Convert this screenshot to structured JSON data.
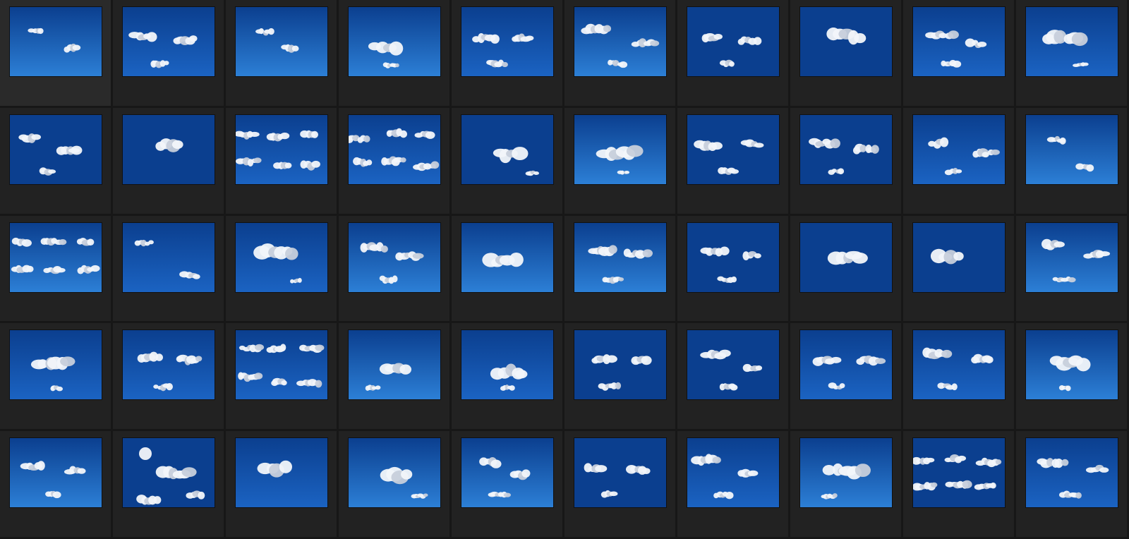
{
  "grid": {
    "rows": 5,
    "columns": 10,
    "colors": {
      "background": "#1f1f1f",
      "cell": "#222222",
      "separator": "#171717",
      "sky_deep": "#0b3f8f",
      "sky_mid": "#1b63c2",
      "sky_light": "#2c7fd6",
      "cloud": "#f2f5fa",
      "cloud_shade": "#c7cfdb"
    },
    "thumbnails": [
      {
        "sky": "light",
        "clouds": "sparse"
      },
      {
        "sky": "mid",
        "clouds": "scattered"
      },
      {
        "sky": "light",
        "clouds": "sparse"
      },
      {
        "sky": "light",
        "clouds": "single"
      },
      {
        "sky": "mid",
        "clouds": "scattered"
      },
      {
        "sky": "light",
        "clouds": "scattered"
      },
      {
        "sky": "deep",
        "clouds": "scattered"
      },
      {
        "sky": "deep",
        "clouds": "single"
      },
      {
        "sky": "mid",
        "clouds": "scattered"
      },
      {
        "sky": "mid",
        "clouds": "single"
      },
      {
        "sky": "deep",
        "clouds": "scattered"
      },
      {
        "sky": "deep",
        "clouds": "single"
      },
      {
        "sky": "mid",
        "clouds": "dense"
      },
      {
        "sky": "mid",
        "clouds": "dense"
      },
      {
        "sky": "deep",
        "clouds": "single"
      },
      {
        "sky": "light",
        "clouds": "single"
      },
      {
        "sky": "deep",
        "clouds": "scattered"
      },
      {
        "sky": "deep",
        "clouds": "scattered"
      },
      {
        "sky": "mid",
        "clouds": "scattered"
      },
      {
        "sky": "light",
        "clouds": "sparse"
      },
      {
        "sky": "light",
        "clouds": "dense"
      },
      {
        "sky": "mid",
        "clouds": "sparse"
      },
      {
        "sky": "mid",
        "clouds": "single"
      },
      {
        "sky": "light",
        "clouds": "scattered"
      },
      {
        "sky": "light",
        "clouds": "single"
      },
      {
        "sky": "light",
        "clouds": "scattered"
      },
      {
        "sky": "deep",
        "clouds": "scattered"
      },
      {
        "sky": "deep",
        "clouds": "single"
      },
      {
        "sky": "deep",
        "clouds": "single"
      },
      {
        "sky": "light",
        "clouds": "scattered"
      },
      {
        "sky": "mid",
        "clouds": "single"
      },
      {
        "sky": "mid",
        "clouds": "scattered"
      },
      {
        "sky": "mid",
        "clouds": "dense"
      },
      {
        "sky": "light",
        "clouds": "single"
      },
      {
        "sky": "mid",
        "clouds": "single"
      },
      {
        "sky": "deep",
        "clouds": "scattered"
      },
      {
        "sky": "deep",
        "clouds": "scattered"
      },
      {
        "sky": "mid",
        "clouds": "scattered"
      },
      {
        "sky": "mid",
        "clouds": "scattered"
      },
      {
        "sky": "light",
        "clouds": "single"
      },
      {
        "sky": "light",
        "clouds": "scattered"
      },
      {
        "sky": "deep",
        "clouds": "sun"
      },
      {
        "sky": "mid",
        "clouds": "single"
      },
      {
        "sky": "light",
        "clouds": "single"
      },
      {
        "sky": "light",
        "clouds": "scattered"
      },
      {
        "sky": "deep",
        "clouds": "scattered"
      },
      {
        "sky": "mid",
        "clouds": "scattered"
      },
      {
        "sky": "light",
        "clouds": "single"
      },
      {
        "sky": "deep",
        "clouds": "dense"
      },
      {
        "sky": "mid",
        "clouds": "scattered"
      }
    ]
  }
}
